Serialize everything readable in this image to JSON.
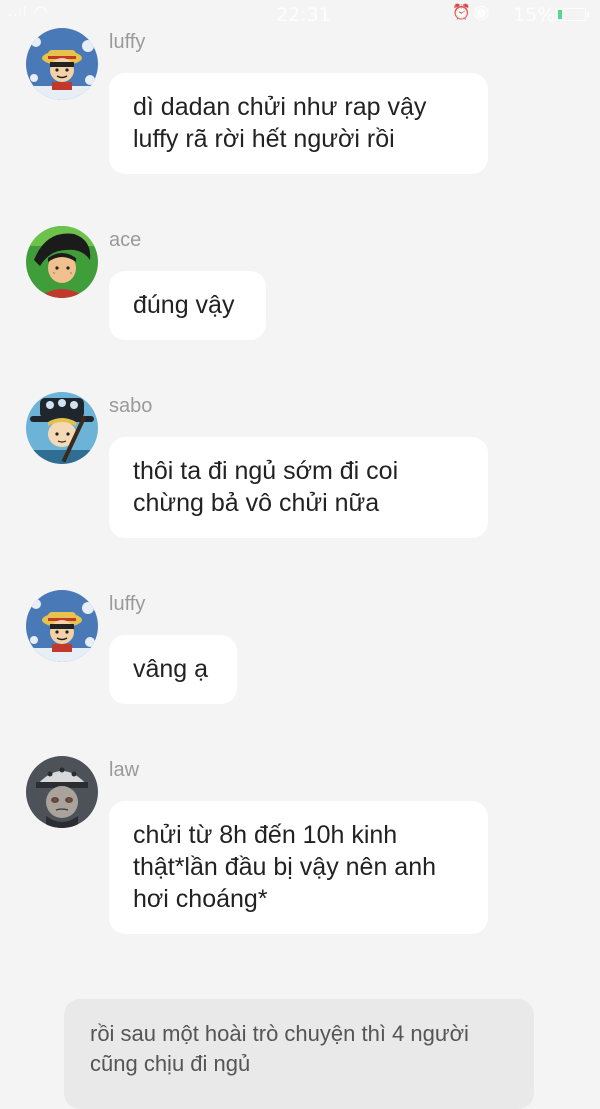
{
  "status_bar": {
    "signal": "..ıl",
    "time": "22:31",
    "battery_percent": "15%",
    "battery_level": 0.15,
    "battery_color": "#3ad27a",
    "icons": [
      "signal-icon",
      "wifi-icon",
      "alarm-icon",
      "eye-icon",
      "battery-icon"
    ]
  },
  "messages": [
    {
      "sender": "luffy",
      "text": "dì dadan chửi như rap vậy\nluffy rã rời hết người rồi",
      "avatar": "luffy-avatar"
    },
    {
      "sender": "ace",
      "text": "đúng vậy",
      "avatar": "ace-avatar"
    },
    {
      "sender": "sabo",
      "text": "thôi ta đi ngủ sớm đi coi\nchừng bả vô chửi nữa",
      "avatar": "sabo-avatar"
    },
    {
      "sender": "luffy",
      "text": "vâng ạ",
      "avatar": "luffy-avatar"
    },
    {
      "sender": "law",
      "text": "chửi từ 8h đến 10h kinh\nthật*lần đầu bị vậy nên anh\nhơi choáng*",
      "avatar": "law-avatar"
    }
  ],
  "narration": "rồi sau một hoài trò chuyện thì 4 người cũng chịu đi ngủ",
  "colors": {
    "background": "#f4f4f4",
    "bubble": "#ffffff",
    "narration_bubble": "#e9e9e9",
    "sender_text": "#9a9a9a"
  }
}
